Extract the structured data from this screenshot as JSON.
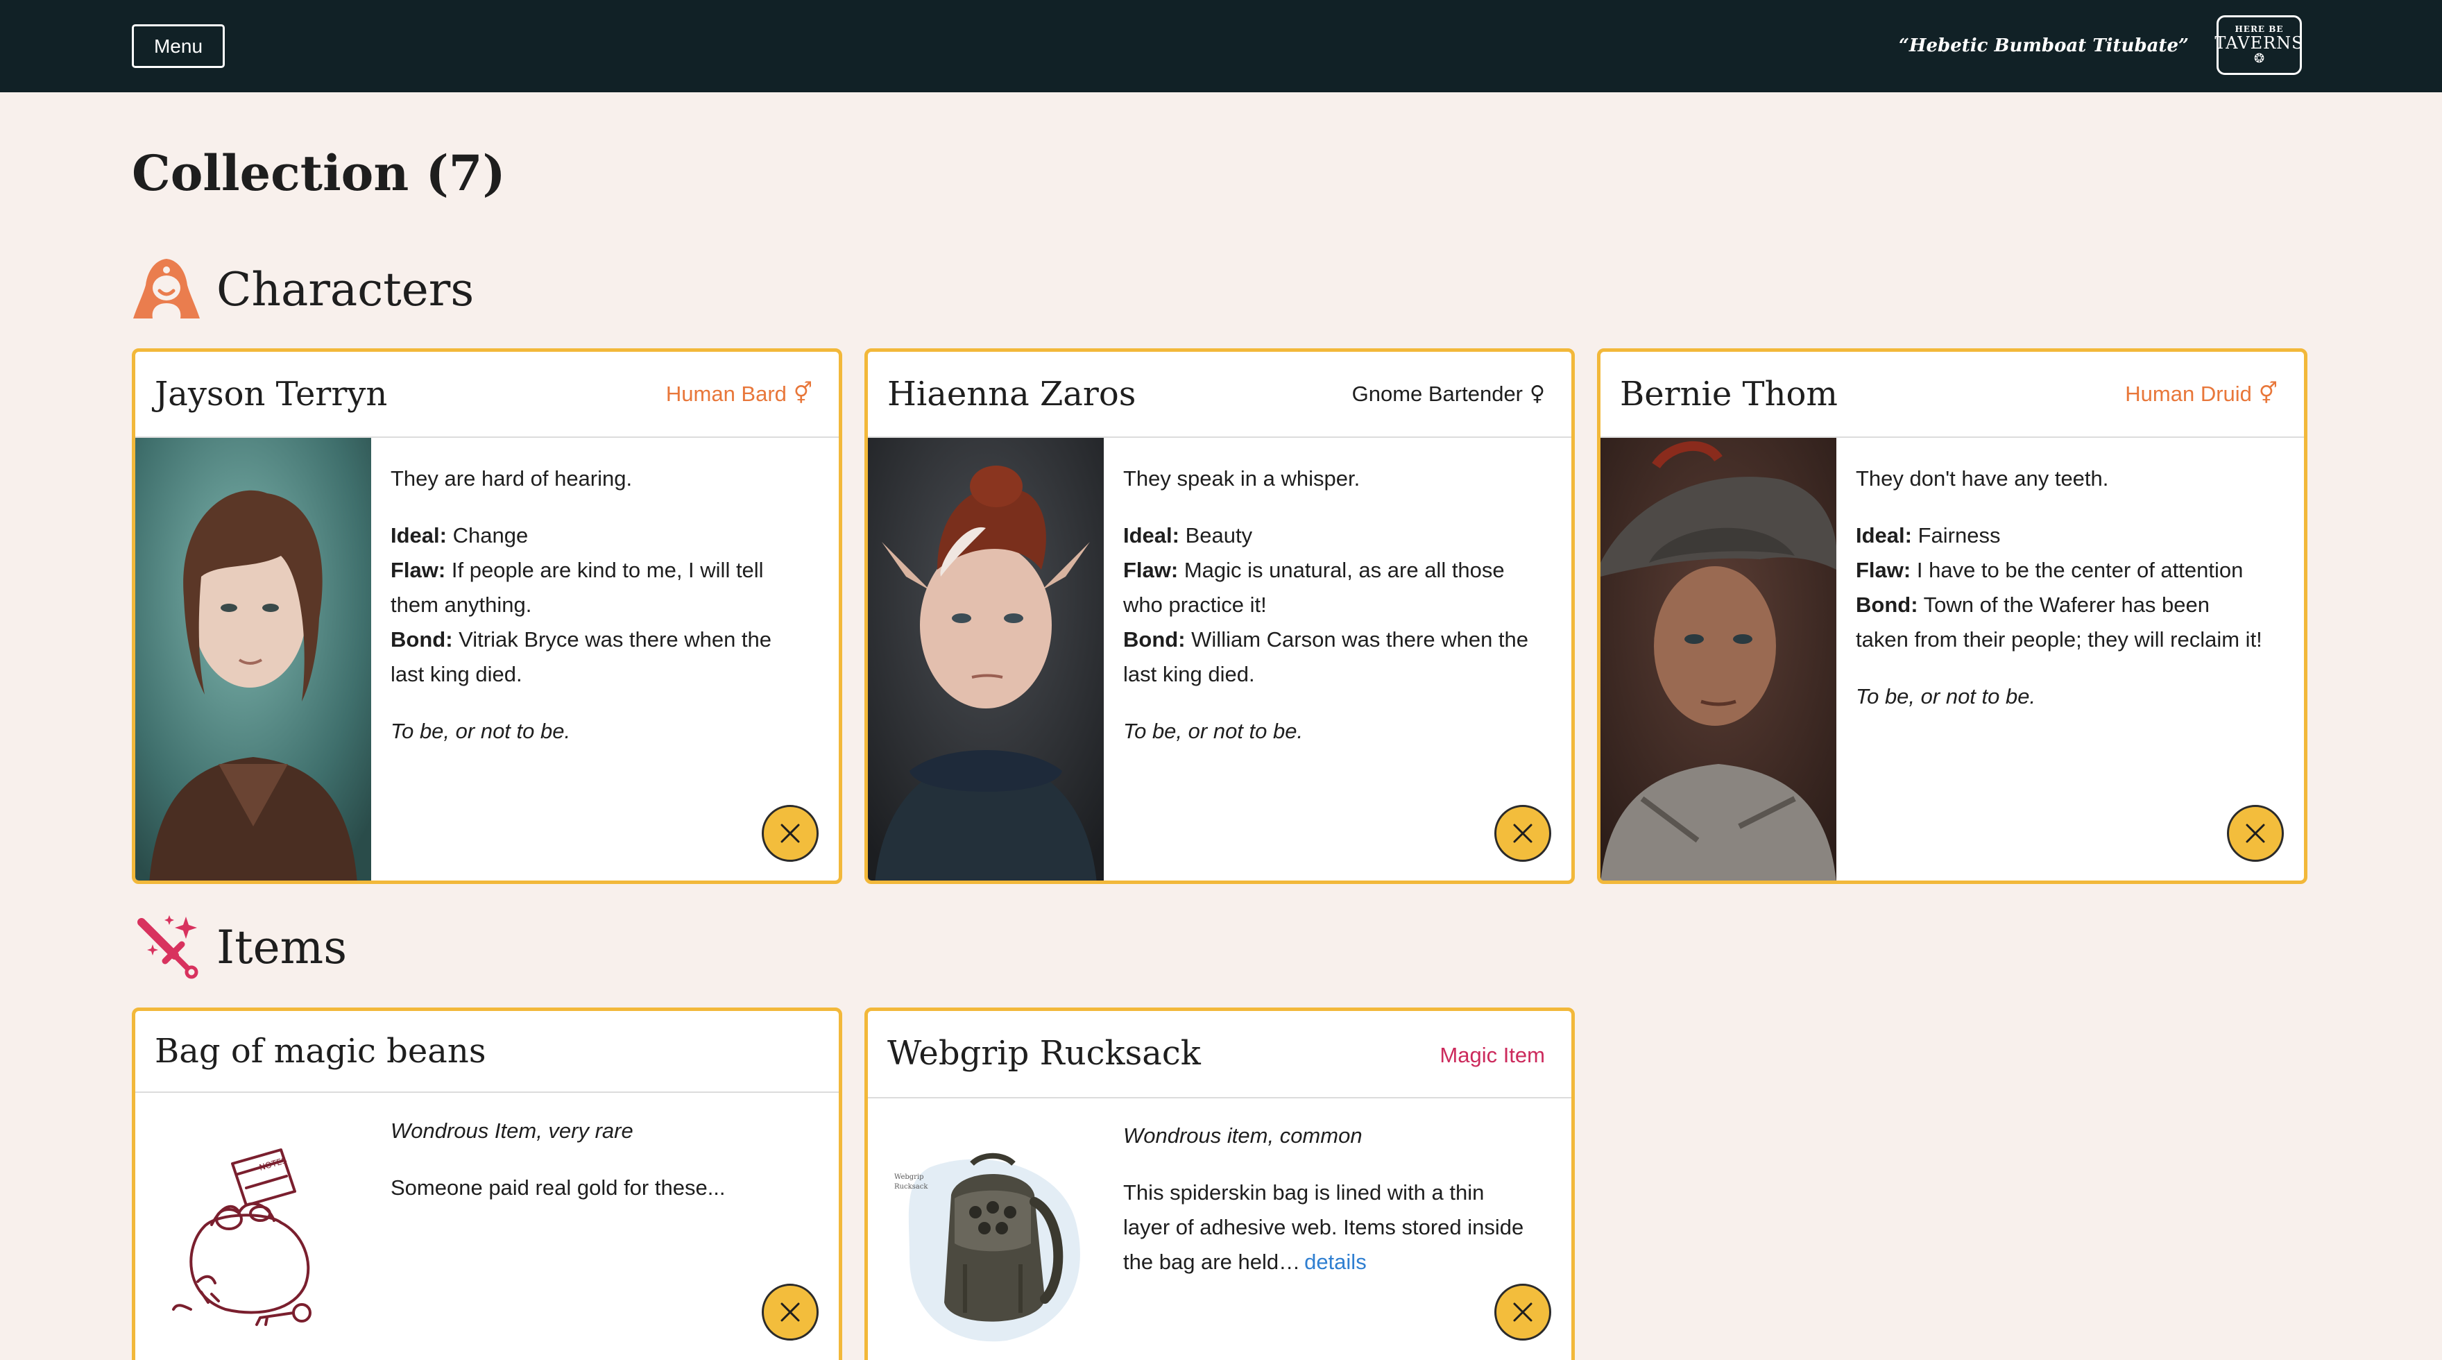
{
  "header": {
    "menu_label": "Menu",
    "tagline": "“Hebetic Bumboat Titubate”",
    "logo": {
      "line1": "HERE BE",
      "line2": "TAVERNS",
      "mark": "❂"
    }
  },
  "page": {
    "title": "Collection (7)"
  },
  "sections": {
    "characters": {
      "title": "Characters",
      "icon": "hooded-figure-icon"
    },
    "items": {
      "title": "Items",
      "icon": "magic-sword-icon"
    }
  },
  "colors": {
    "topbar": "#112126",
    "page_bg": "#f8f0ec",
    "card_border": "#f2b83a",
    "human_tag": "#e8773a",
    "magic_tag": "#cc2a5c",
    "remove_button": "#f3bd3c",
    "link": "#2f7fd1"
  },
  "characters": [
    {
      "name": "Jayson Terryn",
      "tag": "Human Bard",
      "gender_symbol": "⚥",
      "tag_color": "#e8773a",
      "trait": "They are hard of hearing.",
      "ideal_label": "Ideal:",
      "ideal": "Change",
      "flaw_label": "Flaw:",
      "flaw": "If people are kind to me, I will tell them anything.",
      "bond_label": "Bond:",
      "bond": "Vitriak Bryce was there when the last king died.",
      "quote": "To be, or not to be.",
      "remove_icon": "close-icon"
    },
    {
      "name": "Hiaenna Zaros",
      "tag": "Gnome Bartender",
      "gender_symbol": "♀",
      "tag_color": "#1e1e1e",
      "trait": "They speak in a whisper.",
      "ideal_label": "Ideal:",
      "ideal": "Beauty",
      "flaw_label": "Flaw:",
      "flaw": "Magic is unatural, as are all those who practice it!",
      "bond_label": "Bond:",
      "bond": "William Carson was there when the last king died.",
      "quote": "To be, or not to be.",
      "remove_icon": "close-icon"
    },
    {
      "name": "Bernie Thom",
      "tag": "Human Druid",
      "gender_symbol": "⚥",
      "tag_color": "#e8773a",
      "trait": "They don't have any teeth.",
      "ideal_label": "Ideal:",
      "ideal": "Fairness",
      "flaw_label": "Flaw:",
      "flaw": "I have to be the center of attention",
      "bond_label": "Bond:",
      "bond": "Town of the Waferer has been taken from their people; they will reclaim it!",
      "quote": "To be, or not to be.",
      "remove_icon": "close-icon"
    }
  ],
  "items": [
    {
      "name": "Bag of magic beans",
      "tag": "",
      "subtitle": "Wondrous Item, very rare",
      "description": "Someone paid real gold for these...",
      "image": "bean-bag-sketch",
      "remove_icon": "close-icon"
    },
    {
      "name": "Webgrip Rucksack",
      "tag": "Magic Item",
      "subtitle": "Wondrous item, common",
      "description": "This spiderskin bag is lined with a thin layer of adhesive web. Items stored inside the bag are held…",
      "details_label": "details",
      "image": "rucksack-illustration",
      "image_caption": "Webgrip Rucksack",
      "remove_icon": "close-icon"
    }
  ]
}
